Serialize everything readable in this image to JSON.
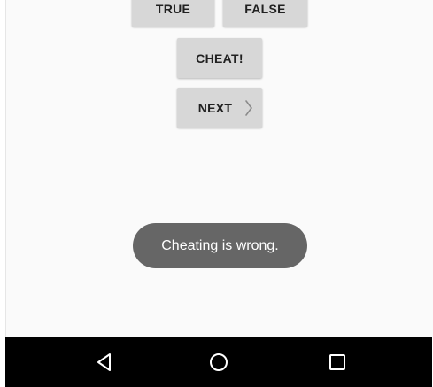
{
  "buttons": {
    "true_label": "TRUE",
    "false_label": "FALSE",
    "cheat_label": "CHEAT!",
    "next_label": "NEXT"
  },
  "toast": {
    "message": "Cheating is wrong."
  },
  "icons": {
    "next": "chevron-right-icon",
    "back": "back-triangle-icon",
    "home": "home-circle-icon",
    "recents": "recents-square-icon"
  },
  "colors": {
    "screen_background": "#fafafa",
    "button_background": "#d7d7d7",
    "button_text": "#212121",
    "toast_background": "#666666",
    "toast_text": "#ffffff",
    "navbar_background": "#000000",
    "navbar_icon": "#ffffff"
  }
}
